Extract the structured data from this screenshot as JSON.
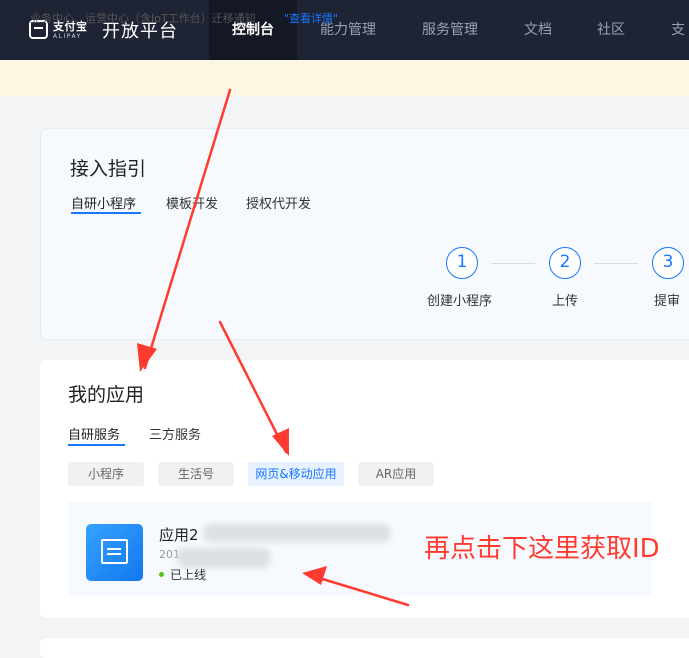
{
  "header": {
    "logo_cn": "支付宝",
    "logo_en": "ALIPAY",
    "brand": "开放平台",
    "nav": [
      "控制台",
      "能力管理",
      "服务管理",
      "文档",
      "社区",
      "支"
    ]
  },
  "notice": {
    "text": "业务中心、运营中心（含IoT工作台）迁移通知",
    "link": "\"查看详情\""
  },
  "guide": {
    "title": "接入指引",
    "tabs": [
      "自研小程序",
      "模板开发",
      "授权代开发"
    ],
    "steps": [
      {
        "num": "1",
        "label": "创建小程序"
      },
      {
        "num": "2",
        "label": "上传"
      },
      {
        "num": "3",
        "label": "提审"
      }
    ]
  },
  "my_apps": {
    "title": "我的应用",
    "tabs": [
      "自研服务",
      "三方服务"
    ],
    "filters": [
      "小程序",
      "生活号",
      "网页&移动应用",
      "AR应用"
    ],
    "app": {
      "name": "应用2",
      "date": "201",
      "status": "已上线"
    }
  },
  "annotation": "再点击下这里获取ID",
  "colors": {
    "accent": "#1677ff",
    "annotation": "#ff3b30",
    "topbar": "#1f2434"
  }
}
